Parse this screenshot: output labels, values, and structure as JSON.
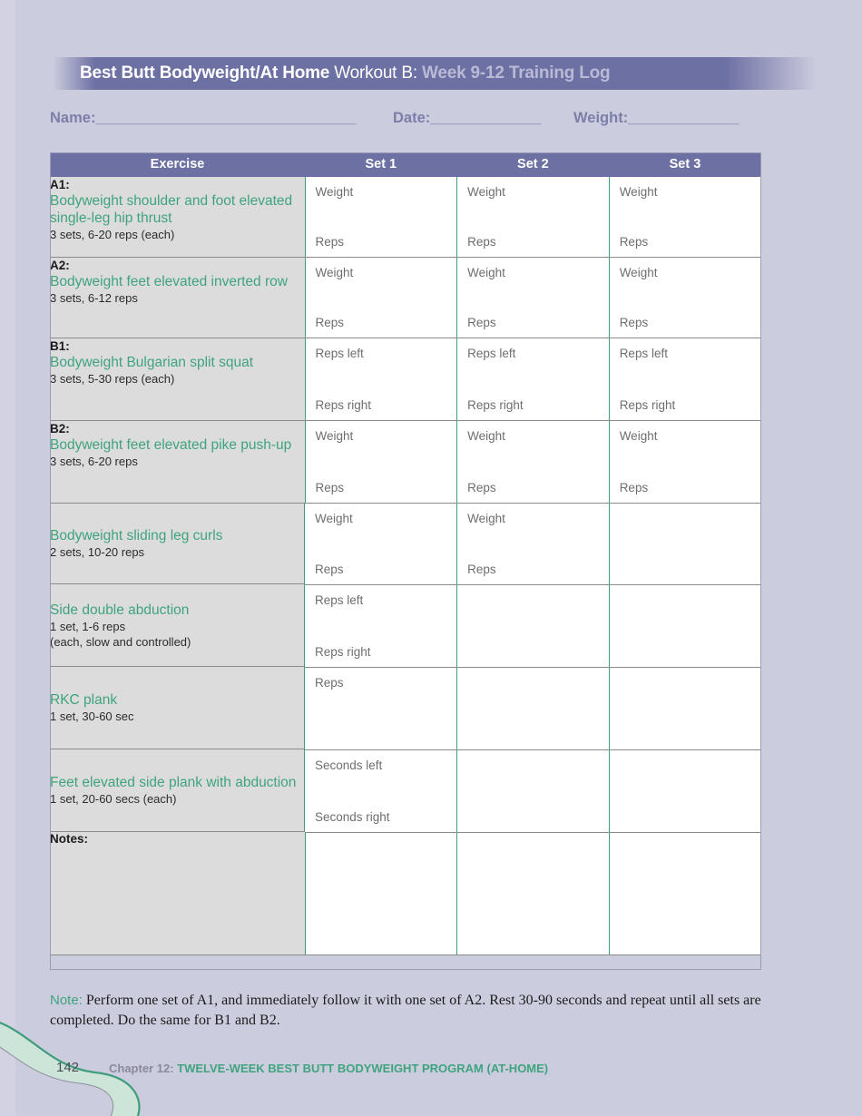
{
  "header": {
    "title_bold": "Best Butt Bodyweight/At Home",
    "title_regular": " Workout B:",
    "title_muted": " Week 9-12 Training Log"
  },
  "fields": {
    "name_label": "Name:",
    "name_blank": "_________________________________",
    "date_label": "Date:",
    "date_blank": "______________",
    "weight_label": "Weight:",
    "weight_blank": "______________"
  },
  "table": {
    "columns": [
      "Exercise",
      "Set 1",
      "Set 2",
      "Set 3"
    ],
    "rows": [
      {
        "code": "A1:",
        "name": "Bodyweight shoulder and foot elevated single-leg hip thrust",
        "sets": "3 sets, 6-20 reps (each)",
        "extra": "",
        "cells": [
          {
            "top": "Weight",
            "bottom": "Reps"
          },
          {
            "top": "Weight",
            "bottom": "Reps"
          },
          {
            "top": "Weight",
            "bottom": "Reps"
          }
        ]
      },
      {
        "code": "A2:",
        "name": "Bodyweight feet elevated inverted row",
        "sets": "3 sets, 6-12 reps",
        "extra": "",
        "cells": [
          {
            "top": "Weight",
            "bottom": "Reps"
          },
          {
            "top": "Weight",
            "bottom": "Reps"
          },
          {
            "top": "Weight",
            "bottom": "Reps"
          }
        ]
      },
      {
        "code": "B1:",
        "name": "Bodyweight Bulgarian split squat",
        "sets": "3 sets, 5-30 reps (each)",
        "extra": "",
        "cells": [
          {
            "top": "Reps left",
            "bottom": "Reps right"
          },
          {
            "top": "Reps left",
            "bottom": "Reps right"
          },
          {
            "top": "Reps left",
            "bottom": "Reps right"
          }
        ]
      },
      {
        "code": "B2:",
        "name": "Bodyweight feet elevated pike push-up",
        "sets": "3 sets, 6-20 reps",
        "extra": "",
        "cells": [
          {
            "top": "Weight",
            "bottom": "Reps"
          },
          {
            "top": "Weight",
            "bottom": "Reps"
          },
          {
            "top": "Weight",
            "bottom": "Reps"
          }
        ]
      },
      {
        "code": "",
        "name": "Bodyweight sliding leg curls",
        "sets": "2 sets, 10-20 reps",
        "extra": "",
        "cells": [
          {
            "top": "Weight",
            "bottom": "Reps"
          },
          {
            "top": "Weight",
            "bottom": "Reps"
          },
          {
            "top": "",
            "bottom": ""
          }
        ]
      },
      {
        "code": "",
        "name": "Side double abduction",
        "sets": "1 set, 1-6 reps",
        "extra": "(each, slow and controlled)",
        "cells": [
          {
            "top": "Reps left",
            "bottom": "Reps right"
          },
          {
            "top": "",
            "bottom": ""
          },
          {
            "top": "",
            "bottom": ""
          }
        ]
      },
      {
        "code": "",
        "name": "RKC plank",
        "sets": "1 set, 30-60 sec",
        "extra": "",
        "cells": [
          {
            "top": "Reps",
            "bottom": ""
          },
          {
            "top": "",
            "bottom": ""
          },
          {
            "top": "",
            "bottom": ""
          }
        ]
      },
      {
        "code": "",
        "name": "Feet elevated side plank with abduction",
        "sets": "1 set, 20-60 secs (each)",
        "extra": "",
        "cells": [
          {
            "top": "Seconds left",
            "bottom": "Seconds right"
          },
          {
            "top": "",
            "bottom": ""
          },
          {
            "top": "",
            "bottom": ""
          }
        ]
      }
    ],
    "notes_label": "Notes:"
  },
  "footer": {
    "note_label": "Note:",
    "note_text": " Perform one set of A1, and immediately follow it with one set of A2. Rest 30-90 seconds and repeat until all sets are completed. Do the same for B1 and B2.",
    "page_number": "142",
    "chapter_number": "Chapter 12: ",
    "chapter_title": "TWELVE-WEEK BEST BUTT BODYWEIGHT PROGRAM (AT-HOME)"
  },
  "colors": {
    "page_background": "#ccccdf",
    "header_purple": "#6d70a3",
    "teal": "#3fa47e",
    "exercise_cell_grey": "#dcdcdc",
    "muted_purple_text": "#7b7ea8"
  }
}
